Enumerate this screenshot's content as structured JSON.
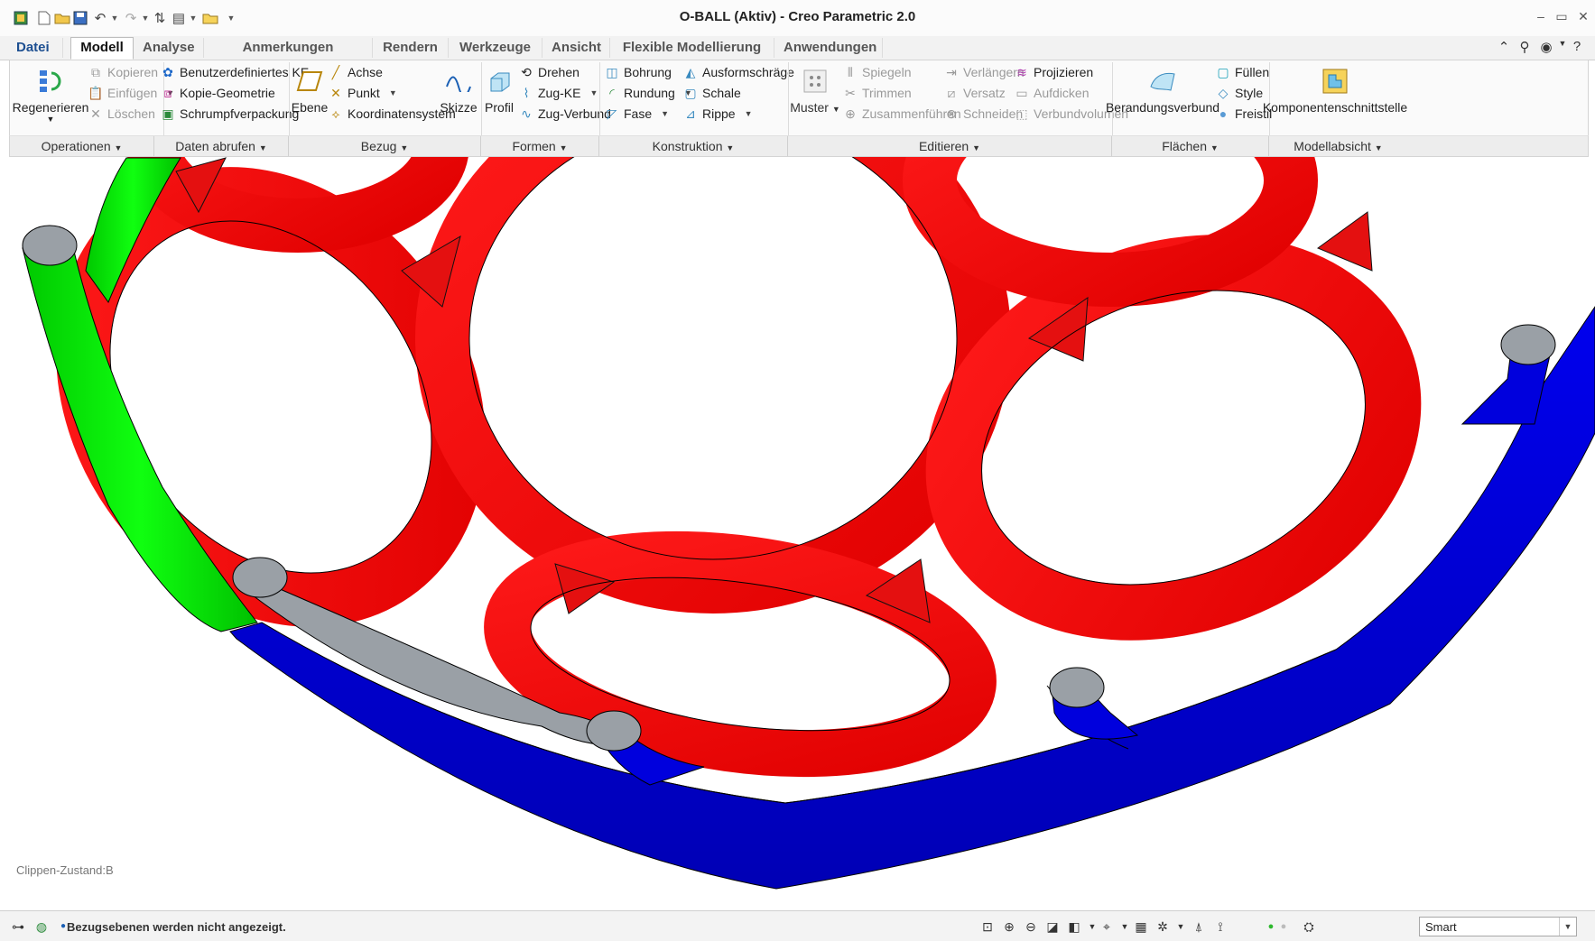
{
  "window": {
    "title": "O-BALL (Aktiv) - Creo Parametric 2.0"
  },
  "tabs": [
    {
      "label": "Datei"
    },
    {
      "label": "Modell"
    },
    {
      "label": "Analyse"
    },
    {
      "label": "Anmerkungen erstellen"
    },
    {
      "label": "Rendern"
    },
    {
      "label": "Werkzeuge"
    },
    {
      "label": "Ansicht"
    },
    {
      "label": "Flexible Modellierung"
    },
    {
      "label": "Anwendungen"
    }
  ],
  "ribbon": {
    "regenerieren": "Regenerieren",
    "kopieren": "Kopieren",
    "einfuegen": "Einfügen",
    "loeschen": "Löschen",
    "benutzerdef": "Benutzerdefiniertes KE",
    "kopie_geometrie": "Kopie-Geometrie",
    "schrumpf": "Schrumpfverpackung",
    "ebene": "Ebene",
    "achse": "Achse",
    "punkt": "Punkt",
    "koordinatensystem": "Koordinatensystem",
    "skizze": "Skizze",
    "profil": "Profil",
    "drehen": "Drehen",
    "zug_ke": "Zug-KE",
    "zug_verbund": "Zug-Verbund",
    "bohrung": "Bohrung",
    "rundung": "Rundung",
    "fase": "Fase",
    "ausformschraege": "Ausformschräge",
    "schale": "Schale",
    "rippe": "Rippe",
    "muster": "Muster",
    "spiegeln": "Spiegeln",
    "trimmen": "Trimmen",
    "zusammenfuehren": "Zusammenführen",
    "verlaengern": "Verlängern",
    "versatz": "Versatz",
    "schneiden": "Schneiden",
    "projizieren": "Projizieren",
    "aufdicken": "Aufdicken",
    "verbundvolumen": "Verbundvolumen",
    "berandungsverbund": "Berandungsverbund",
    "fuellen": "Füllen",
    "style": "Style",
    "freistil": "Freistil",
    "komponentenschnittstelle": "Komponentenschnittstelle"
  },
  "groups": [
    {
      "label": "Operationen"
    },
    {
      "label": "Daten abrufen"
    },
    {
      "label": "Bezug"
    },
    {
      "label": "Formen"
    },
    {
      "label": "Konstruktion"
    },
    {
      "label": "Editieren"
    },
    {
      "label": "Flächen"
    },
    {
      "label": "Modellabsicht"
    }
  ],
  "viewport": {
    "clip_state": "Clippen-Zustand:B"
  },
  "statusbar": {
    "message": "Bezugsebenen werden nicht angezeigt.",
    "filter": "Smart"
  },
  "colors": {
    "red": "#ff0000",
    "green": "#00e000",
    "blue": "#0000dd",
    "grey": "#9aa0a6"
  }
}
